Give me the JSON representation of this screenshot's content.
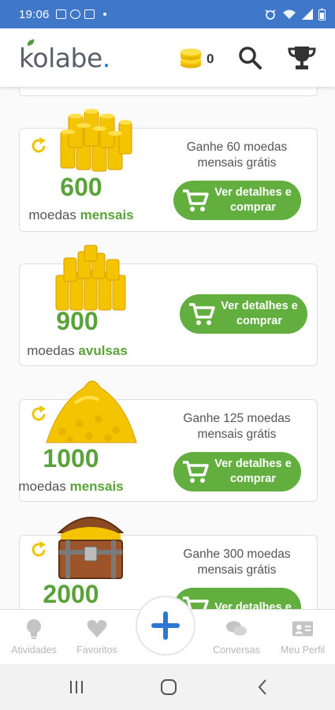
{
  "status_bar": {
    "time": "19:06"
  },
  "header": {
    "logo_text": "kolabe",
    "logo_dot": ".",
    "coin_count": "0",
    "brand_color": "#62ae3f"
  },
  "offers": [
    {
      "amount": "600",
      "label_prefix": "moedas ",
      "label_kind": "mensais",
      "description": "Ganhe 60 moedas mensais grátis",
      "button_label": "Ver detalhes e comprar",
      "icon": "coin-stacks"
    },
    {
      "amount": "900",
      "label_prefix": "moedas ",
      "label_kind": "avulsas",
      "description": "",
      "button_label": "Ver detalhes e comprar",
      "icon": "coin-pyramid"
    },
    {
      "amount": "1000",
      "label_prefix": "moedas ",
      "label_kind": "mensais",
      "description": "Ganhe 125 moedas mensais grátis",
      "button_label": "Ver detalhes e comprar",
      "icon": "coin-pile"
    },
    {
      "amount": "2000",
      "label_prefix": "",
      "label_kind": "",
      "description": "Ganhe 300 moedas mensais grátis",
      "button_label": "Ver detalhes e",
      "icon": "treasure-chest"
    }
  ],
  "bottom_nav": {
    "items": [
      {
        "label": "Atividades",
        "icon": "lightbulb-icon"
      },
      {
        "label": "Favoritos",
        "icon": "heart-icon"
      },
      {
        "label": "Conversas",
        "icon": "chat-icon"
      },
      {
        "label": "Meu Perfil",
        "icon": "profile-card-icon"
      }
    ],
    "fab_icon": "plus-icon"
  }
}
